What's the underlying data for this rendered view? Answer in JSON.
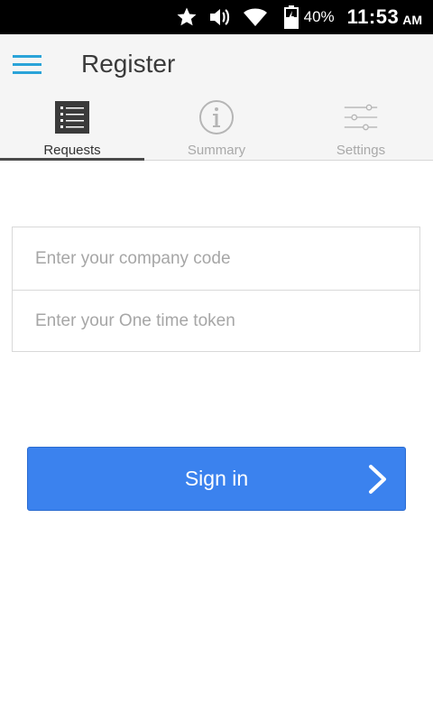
{
  "status_bar": {
    "battery_percent": "40%",
    "time": "11:53",
    "ampm": "AM",
    "icons": [
      "star-icon",
      "volume-icon",
      "wifi-icon",
      "battery-charging-icon"
    ]
  },
  "app_bar": {
    "title": "Register",
    "menu_icon": "hamburger-menu-icon",
    "accent_color": "#2aa3d8"
  },
  "tabs": [
    {
      "label": "Requests",
      "icon": "list-icon",
      "active": true
    },
    {
      "label": "Summary",
      "icon": "info-icon",
      "active": false
    },
    {
      "label": "Settings",
      "icon": "sliders-icon",
      "active": false
    }
  ],
  "form": {
    "company_code_placeholder": "Enter your company code",
    "company_code_value": "",
    "token_placeholder": "Enter your One time token",
    "token_value": ""
  },
  "signin": {
    "label": "Sign in",
    "icon": "chevron-right-icon",
    "color": "#3b82ee"
  }
}
